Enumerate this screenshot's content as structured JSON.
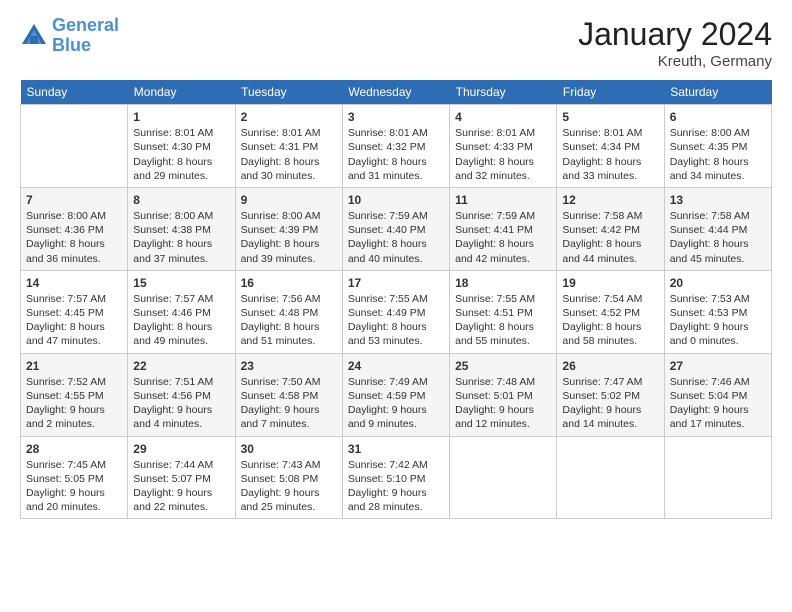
{
  "header": {
    "logo_line1": "General",
    "logo_line2": "Blue",
    "title": "January 2024",
    "subtitle": "Kreuth, Germany"
  },
  "weekdays": [
    "Sunday",
    "Monday",
    "Tuesday",
    "Wednesday",
    "Thursday",
    "Friday",
    "Saturday"
  ],
  "weeks": [
    [
      {
        "day": "",
        "sunrise": "",
        "sunset": "",
        "daylight": ""
      },
      {
        "day": "1",
        "sunrise": "Sunrise: 8:01 AM",
        "sunset": "Sunset: 4:30 PM",
        "daylight": "Daylight: 8 hours and 29 minutes."
      },
      {
        "day": "2",
        "sunrise": "Sunrise: 8:01 AM",
        "sunset": "Sunset: 4:31 PM",
        "daylight": "Daylight: 8 hours and 30 minutes."
      },
      {
        "day": "3",
        "sunrise": "Sunrise: 8:01 AM",
        "sunset": "Sunset: 4:32 PM",
        "daylight": "Daylight: 8 hours and 31 minutes."
      },
      {
        "day": "4",
        "sunrise": "Sunrise: 8:01 AM",
        "sunset": "Sunset: 4:33 PM",
        "daylight": "Daylight: 8 hours and 32 minutes."
      },
      {
        "day": "5",
        "sunrise": "Sunrise: 8:01 AM",
        "sunset": "Sunset: 4:34 PM",
        "daylight": "Daylight: 8 hours and 33 minutes."
      },
      {
        "day": "6",
        "sunrise": "Sunrise: 8:00 AM",
        "sunset": "Sunset: 4:35 PM",
        "daylight": "Daylight: 8 hours and 34 minutes."
      }
    ],
    [
      {
        "day": "7",
        "sunrise": "Sunrise: 8:00 AM",
        "sunset": "Sunset: 4:36 PM",
        "daylight": "Daylight: 8 hours and 36 minutes."
      },
      {
        "day": "8",
        "sunrise": "Sunrise: 8:00 AM",
        "sunset": "Sunset: 4:38 PM",
        "daylight": "Daylight: 8 hours and 37 minutes."
      },
      {
        "day": "9",
        "sunrise": "Sunrise: 8:00 AM",
        "sunset": "Sunset: 4:39 PM",
        "daylight": "Daylight: 8 hours and 39 minutes."
      },
      {
        "day": "10",
        "sunrise": "Sunrise: 7:59 AM",
        "sunset": "Sunset: 4:40 PM",
        "daylight": "Daylight: 8 hours and 40 minutes."
      },
      {
        "day": "11",
        "sunrise": "Sunrise: 7:59 AM",
        "sunset": "Sunset: 4:41 PM",
        "daylight": "Daylight: 8 hours and 42 minutes."
      },
      {
        "day": "12",
        "sunrise": "Sunrise: 7:58 AM",
        "sunset": "Sunset: 4:42 PM",
        "daylight": "Daylight: 8 hours and 44 minutes."
      },
      {
        "day": "13",
        "sunrise": "Sunrise: 7:58 AM",
        "sunset": "Sunset: 4:44 PM",
        "daylight": "Daylight: 8 hours and 45 minutes."
      }
    ],
    [
      {
        "day": "14",
        "sunrise": "Sunrise: 7:57 AM",
        "sunset": "Sunset: 4:45 PM",
        "daylight": "Daylight: 8 hours and 47 minutes."
      },
      {
        "day": "15",
        "sunrise": "Sunrise: 7:57 AM",
        "sunset": "Sunset: 4:46 PM",
        "daylight": "Daylight: 8 hours and 49 minutes."
      },
      {
        "day": "16",
        "sunrise": "Sunrise: 7:56 AM",
        "sunset": "Sunset: 4:48 PM",
        "daylight": "Daylight: 8 hours and 51 minutes."
      },
      {
        "day": "17",
        "sunrise": "Sunrise: 7:55 AM",
        "sunset": "Sunset: 4:49 PM",
        "daylight": "Daylight: 8 hours and 53 minutes."
      },
      {
        "day": "18",
        "sunrise": "Sunrise: 7:55 AM",
        "sunset": "Sunset: 4:51 PM",
        "daylight": "Daylight: 8 hours and 55 minutes."
      },
      {
        "day": "19",
        "sunrise": "Sunrise: 7:54 AM",
        "sunset": "Sunset: 4:52 PM",
        "daylight": "Daylight: 8 hours and 58 minutes."
      },
      {
        "day": "20",
        "sunrise": "Sunrise: 7:53 AM",
        "sunset": "Sunset: 4:53 PM",
        "daylight": "Daylight: 9 hours and 0 minutes."
      }
    ],
    [
      {
        "day": "21",
        "sunrise": "Sunrise: 7:52 AM",
        "sunset": "Sunset: 4:55 PM",
        "daylight": "Daylight: 9 hours and 2 minutes."
      },
      {
        "day": "22",
        "sunrise": "Sunrise: 7:51 AM",
        "sunset": "Sunset: 4:56 PM",
        "daylight": "Daylight: 9 hours and 4 minutes."
      },
      {
        "day": "23",
        "sunrise": "Sunrise: 7:50 AM",
        "sunset": "Sunset: 4:58 PM",
        "daylight": "Daylight: 9 hours and 7 minutes."
      },
      {
        "day": "24",
        "sunrise": "Sunrise: 7:49 AM",
        "sunset": "Sunset: 4:59 PM",
        "daylight": "Daylight: 9 hours and 9 minutes."
      },
      {
        "day": "25",
        "sunrise": "Sunrise: 7:48 AM",
        "sunset": "Sunset: 5:01 PM",
        "daylight": "Daylight: 9 hours and 12 minutes."
      },
      {
        "day": "26",
        "sunrise": "Sunrise: 7:47 AM",
        "sunset": "Sunset: 5:02 PM",
        "daylight": "Daylight: 9 hours and 14 minutes."
      },
      {
        "day": "27",
        "sunrise": "Sunrise: 7:46 AM",
        "sunset": "Sunset: 5:04 PM",
        "daylight": "Daylight: 9 hours and 17 minutes."
      }
    ],
    [
      {
        "day": "28",
        "sunrise": "Sunrise: 7:45 AM",
        "sunset": "Sunset: 5:05 PM",
        "daylight": "Daylight: 9 hours and 20 minutes."
      },
      {
        "day": "29",
        "sunrise": "Sunrise: 7:44 AM",
        "sunset": "Sunset: 5:07 PM",
        "daylight": "Daylight: 9 hours and 22 minutes."
      },
      {
        "day": "30",
        "sunrise": "Sunrise: 7:43 AM",
        "sunset": "Sunset: 5:08 PM",
        "daylight": "Daylight: 9 hours and 25 minutes."
      },
      {
        "day": "31",
        "sunrise": "Sunrise: 7:42 AM",
        "sunset": "Sunset: 5:10 PM",
        "daylight": "Daylight: 9 hours and 28 minutes."
      },
      {
        "day": "",
        "sunrise": "",
        "sunset": "",
        "daylight": ""
      },
      {
        "day": "",
        "sunrise": "",
        "sunset": "",
        "daylight": ""
      },
      {
        "day": "",
        "sunrise": "",
        "sunset": "",
        "daylight": ""
      }
    ]
  ]
}
